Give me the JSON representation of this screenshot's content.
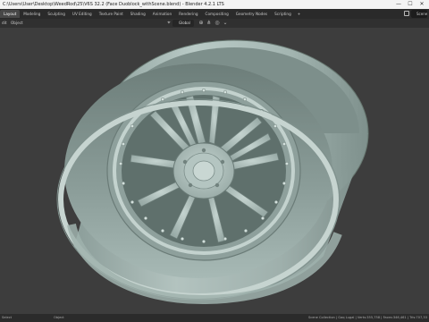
{
  "window": {
    "title": "C:\\Users\\User\\Desktop\\WeedRod\\25\\V6S 32.2 (Face Duoblock_withScene.blend) - Blender 4.2.1 LTS",
    "minimize_glyph": "—",
    "maximize_glyph": "☐",
    "close_glyph": "✕"
  },
  "menubar": {
    "tabs": [
      "Layout",
      "Modeling",
      "Sculpting",
      "UV Editing",
      "Texture Paint",
      "Shading",
      "Animation",
      "Rendering",
      "Compositing",
      "Geometry Nodes",
      "Scripting"
    ],
    "active_tab": "Layout",
    "add_tab": "+",
    "scene_label": "Scene"
  },
  "toolbar": {
    "view_label": "dit",
    "object_label": "Object",
    "orientation": "Global"
  },
  "statusbar": {
    "left": "Select",
    "middle": "Object",
    "right": "Scene Collection | Gaq Lugal | Verts:355,758 | Faces:346,461 | Tris:707,33"
  },
  "icons": [
    "blender-window-icon",
    "orientation-icon",
    "pivot-icon",
    "snap-icon",
    "proportional-icon",
    "scene-icon",
    "mouse-icon"
  ],
  "colors": {
    "viewport_bg": "#3d3d3d",
    "wheel_body": "#a9bbb8",
    "wheel_shadow": "#6f807c",
    "wheel_highlight": "#c7d6d2"
  }
}
